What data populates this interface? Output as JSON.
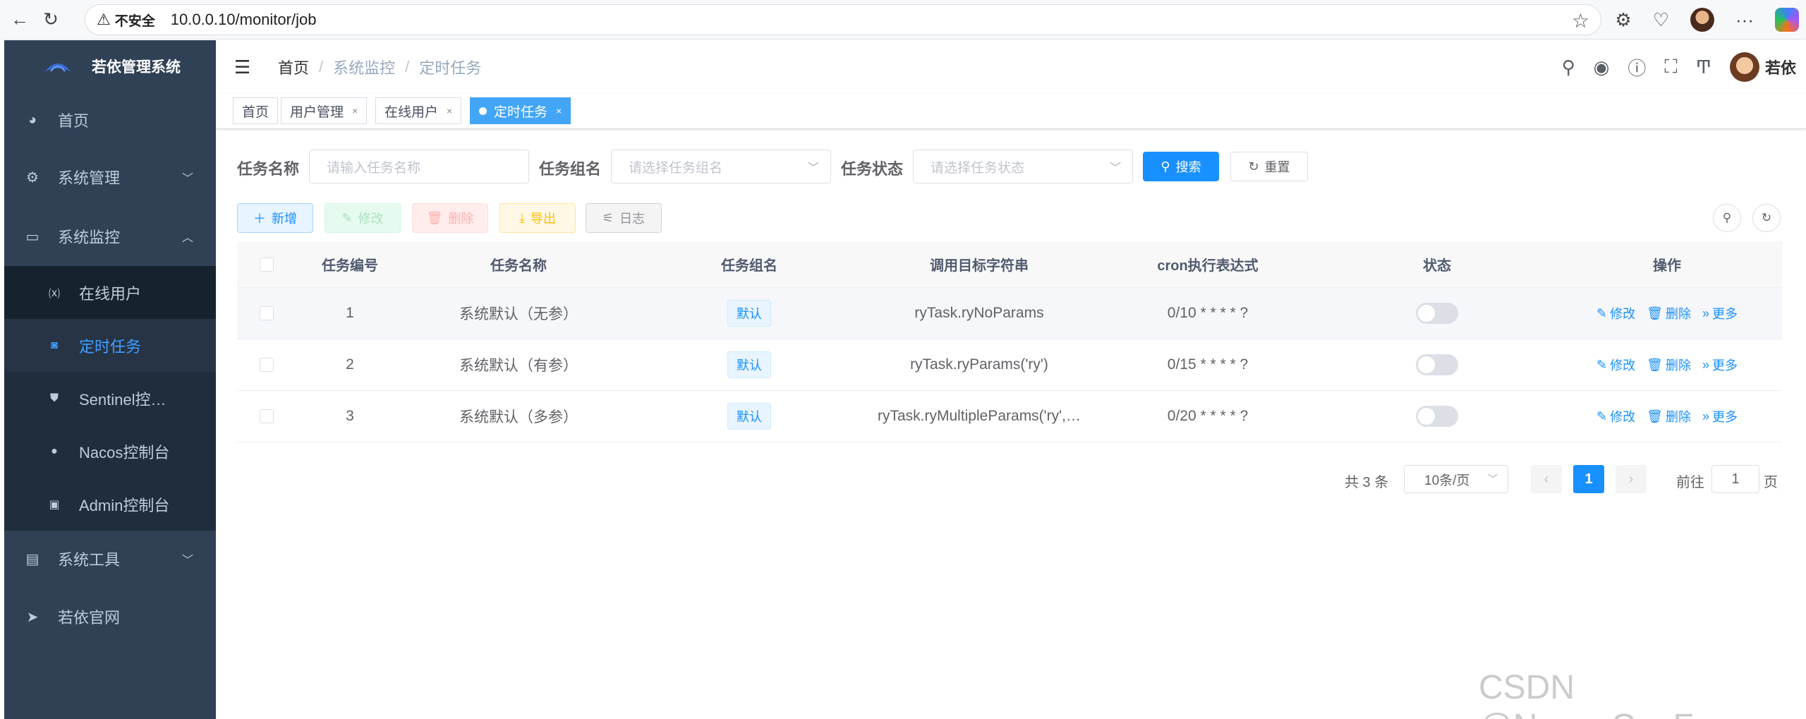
{
  "browser": {
    "insecure_label": "不安全",
    "url": "10.0.0.10/monitor/job"
  },
  "sidebar": {
    "title": "若依管理系统",
    "items": [
      {
        "label": "首页",
        "icon": "dashboard-icon"
      },
      {
        "label": "系统管理",
        "icon": "gear-icon"
      },
      {
        "label": "系统监控",
        "icon": "monitor-icon"
      },
      {
        "label": "系统工具",
        "icon": "toolbox-icon"
      },
      {
        "label": "若依官网",
        "icon": "send-icon"
      }
    ],
    "submenu": [
      {
        "label": "在线用户",
        "icon": "online-icon"
      },
      {
        "label": "定时任务",
        "icon": "job-icon"
      },
      {
        "label": "Sentinel控…",
        "icon": "sentinel-icon"
      },
      {
        "label": "Nacos控制台",
        "icon": "nacos-icon"
      },
      {
        "label": "Admin控制台",
        "icon": "admin-icon"
      }
    ]
  },
  "navbar": {
    "breadcrumb": [
      "首页",
      "系统监控",
      "定时任务"
    ],
    "user_name": "若依"
  },
  "tags": [
    {
      "label": "首页"
    },
    {
      "label": "用户管理"
    },
    {
      "label": "在线用户"
    },
    {
      "label": "定时任务"
    }
  ],
  "search_form": {
    "job_name_label": "任务名称",
    "job_name_placeholder": "请输入任务名称",
    "job_group_label": "任务组名",
    "job_group_placeholder": "请选择任务组名",
    "job_status_label": "任务状态",
    "job_status_placeholder": "请选择任务状态",
    "search_button": "搜索",
    "reset_button": "重置"
  },
  "toolbar": {
    "add": "新增",
    "edit": "修改",
    "delete": "删除",
    "export": "导出",
    "log": "日志"
  },
  "table": {
    "headers": [
      "任务编号",
      "任务名称",
      "任务组名",
      "调用目标字符串",
      "cron执行表达式",
      "状态",
      "操作"
    ],
    "rows": [
      {
        "id": "1",
        "name": "系统默认（无参）",
        "group": "默认",
        "target": "ryTask.ryNoParams",
        "cron": "0/10 * * * * ?",
        "status": false
      },
      {
        "id": "2",
        "name": "系统默认（有参）",
        "group": "默认",
        "target": "ryTask.ryParams('ry')",
        "cron": "0/15 * * * * ?",
        "status": false
      },
      {
        "id": "3",
        "name": "系统默认（多参）",
        "group": "默认",
        "target": "ryTask.ryMultipleParams('ry',…",
        "cron": "0/20 * * * * ?",
        "status": false
      }
    ],
    "ops": {
      "edit": "修改",
      "delete": "删除",
      "more": "更多"
    }
  },
  "pagination": {
    "total_text": "共 3 条",
    "page_size": "10条/页",
    "current_page": "1",
    "goto_prefix": "前往",
    "goto_value": "1",
    "goto_suffix": "页"
  },
  "watermark": "CSDN @Nova_CaoFc",
  "colors": {
    "sidebar_bg": "#304156",
    "submenu_bg": "#1f2d3d",
    "primary": "#1890ff",
    "active_tag": "#42a5f5"
  }
}
